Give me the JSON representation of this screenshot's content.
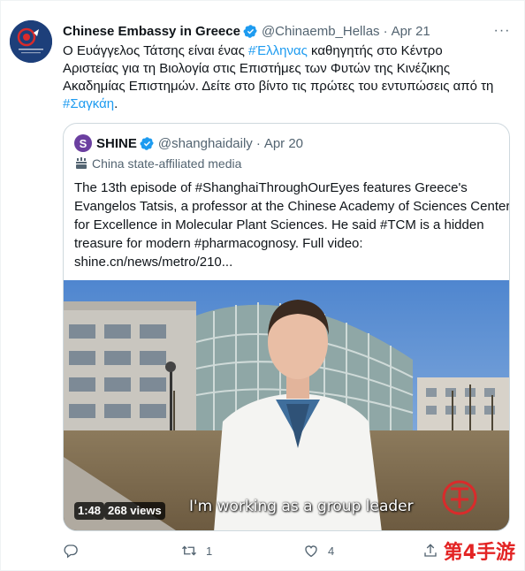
{
  "tweet": {
    "author_name": "Chinese Embassy in Greece",
    "avatar_text": "Chinese Embassy in Greece",
    "handle": "@Chinaemb_Hellas",
    "separator": "·",
    "date": "Apr 21",
    "more_label": "···",
    "text_lines": [
      [
        {
          "t": "Ο Ευάγγελος Τάτσης είναι ένας "
        },
        {
          "t": "#Έλληνας",
          "tag": true
        },
        {
          "t": " καθηγητής στο Κέντρο"
        }
      ],
      [
        {
          "t": "Αριστείας για τη Βιολογία στις Επιστήμες των Φυτών της Κινέζικης"
        }
      ],
      [
        {
          "t": "Ακαδημίας Επιστημών. Δείτε στο βίντο τις πρώτες του εντυπώσεις από τη"
        }
      ],
      [
        {
          "t": "#Σαγκάη",
          "tag": true
        },
        {
          "t": "."
        }
      ]
    ]
  },
  "quote": {
    "avatar_letter": "S",
    "author_name": "SHINE",
    "handle": "@shanghaidaily",
    "separator": "·",
    "date": "Apr 20",
    "label": "China state-affiliated media",
    "text_lines": [
      "The 13th episode of #ShanghaiThroughOurEyes features Greece's",
      "Evangelos Tatsis, a professor at the Chinese Academy of Sciences Center",
      "for Excellence in Molecular Plant Sciences. He said #TCM is a hidden",
      "treasure for modern #pharmacognosy. Full video:",
      "shine.cn/news/metro/210..."
    ],
    "video": {
      "duration": "1:48",
      "views": "268 views",
      "subtitle": "I'm working as a group leader"
    }
  },
  "actions": {
    "reply_icon": "reply-icon",
    "retweet_icon": "retweet-icon",
    "retweet_count": "1",
    "like_icon": "heart-icon",
    "like_count": "4",
    "share_icon": "share-icon"
  },
  "watermark": "第4手游",
  "colors": {
    "accent": "#1d9bf0",
    "text": "#0f1419",
    "muted": "#536471",
    "border": "#cfd9de",
    "watermark": "#e32424"
  }
}
